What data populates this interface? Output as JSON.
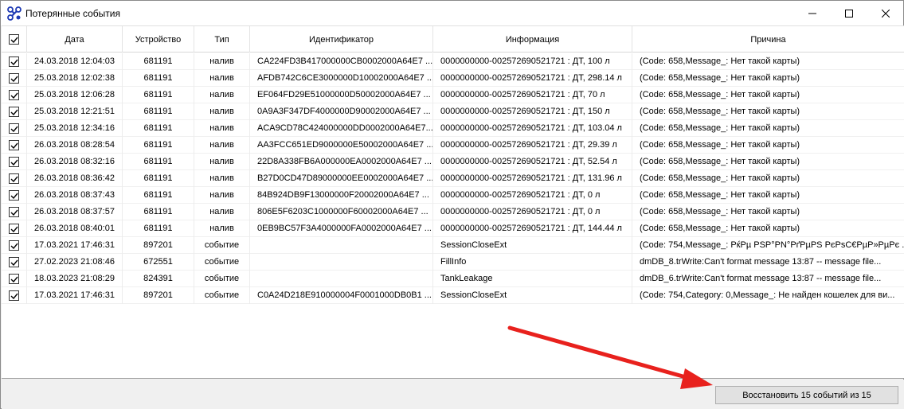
{
  "window": {
    "title": "Потерянные события",
    "accent": "#1e3ab4"
  },
  "columns": [
    "Дата",
    "Устройство",
    "Тип",
    "Идентификатор",
    "Информация",
    "Причина"
  ],
  "header_checked": true,
  "rows": [
    {
      "checked": true,
      "date": "24.03.2018 12:04:03",
      "device": "681191",
      "type": "налив",
      "id": "CA224FD3B417000000CB0002000A64E7 ...",
      "info": "0000000000-002572690521721 : ДТ, 100 л",
      "reason": "(Code: 658,Message_: Нет такой карты)"
    },
    {
      "checked": true,
      "date": "25.03.2018 12:02:38",
      "device": "681191",
      "type": "налив",
      "id": "AFDB742C6CE3000000D10002000A64E7 ...",
      "info": "0000000000-002572690521721 : ДТ, 298.14 л",
      "reason": "(Code: 658,Message_: Нет такой карты)"
    },
    {
      "checked": true,
      "date": "25.03.2018 12:06:28",
      "device": "681191",
      "type": "налив",
      "id": "EF064FD29E51000000D50002000A64E7 ...",
      "info": "0000000000-002572690521721 : ДТ, 70 л",
      "reason": "(Code: 658,Message_: Нет такой карты)"
    },
    {
      "checked": true,
      "date": "25.03.2018 12:21:51",
      "device": "681191",
      "type": "налив",
      "id": "0A9A3F347DF4000000D90002000A64E7 ...",
      "info": "0000000000-002572690521721 : ДТ, 150 л",
      "reason": "(Code: 658,Message_: Нет такой карты)"
    },
    {
      "checked": true,
      "date": "25.03.2018 12:34:16",
      "device": "681191",
      "type": "налив",
      "id": "ACA9CD78C424000000DD0002000A64E7...",
      "info": "0000000000-002572690521721 : ДТ, 103.04 л",
      "reason": "(Code: 658,Message_: Нет такой карты)"
    },
    {
      "checked": true,
      "date": "26.03.2018 08:28:54",
      "device": "681191",
      "type": "налив",
      "id": "AA3FCC651ED9000000E50002000A64E7 ...",
      "info": "0000000000-002572690521721 : ДТ, 29.39 л",
      "reason": "(Code: 658,Message_: Нет такой карты)"
    },
    {
      "checked": true,
      "date": "26.03.2018 08:32:16",
      "device": "681191",
      "type": "налив",
      "id": "22D8A338FB6A000000EA0002000A64E7 ...",
      "info": "0000000000-002572690521721 : ДТ, 52.54 л",
      "reason": "(Code: 658,Message_: Нет такой карты)"
    },
    {
      "checked": true,
      "date": "26.03.2018 08:36:42",
      "device": "681191",
      "type": "налив",
      "id": "B27D0CD47D89000000EE0002000A64E7 ...",
      "info": "0000000000-002572690521721 : ДТ, 131.96 л",
      "reason": "(Code: 658,Message_: Нет такой карты)"
    },
    {
      "checked": true,
      "date": "26.03.2018 08:37:43",
      "device": "681191",
      "type": "налив",
      "id": "84B924DB9F13000000F20002000A64E7 ...",
      "info": "0000000000-002572690521721 : ДТ, 0 л",
      "reason": "(Code: 658,Message_: Нет такой карты)"
    },
    {
      "checked": true,
      "date": "26.03.2018 08:37:57",
      "device": "681191",
      "type": "налив",
      "id": "806E5F6203C1000000F60002000A64E7 ...",
      "info": "0000000000-002572690521721 : ДТ, 0 л",
      "reason": "(Code: 658,Message_: Нет такой карты)"
    },
    {
      "checked": true,
      "date": "26.03.2018 08:40:01",
      "device": "681191",
      "type": "налив",
      "id": "0EB9BC57F3A4000000FA0002000A64E7 ...",
      "info": "0000000000-002572690521721 : ДТ, 144.44 л",
      "reason": "(Code: 658,Message_: Нет такой карты)"
    },
    {
      "checked": true,
      "date": "17.03.2021 17:46:31",
      "device": "897201",
      "type": "событие",
      "id": "",
      "info": "SessionCloseExt",
      "reason": "(Code: 754,Message_: РќРµ PSP°PN°PґPµPS PєPsC€PµP»PµPє ..."
    },
    {
      "checked": true,
      "date": "27.02.2023 21:08:46",
      "device": "672551",
      "type": "событие",
      "id": "",
      "info": "FillInfo",
      "reason": "dmDB_8.trWrite:Can't format message 13:87 -- message file..."
    },
    {
      "checked": true,
      "date": "18.03.2023 21:08:29",
      "device": "824391",
      "type": "событие",
      "id": "",
      "info": "TankLeakage",
      "reason": "dmDB_6.trWrite:Can't format message 13:87 -- message file..."
    },
    {
      "checked": true,
      "date": "17.03.2021 17:46:31",
      "device": "897201",
      "type": "событие",
      "id": "C0A24D218E910000004F0001000DB0B1 ...",
      "info": "SessionCloseExt",
      "reason": "(Code: 754,Category: 0,Message_: Не найден кошелек для ви..."
    }
  ],
  "restore_button": "Восстановить 15 событий из 15",
  "annotation": {
    "color": "#e8211d"
  }
}
